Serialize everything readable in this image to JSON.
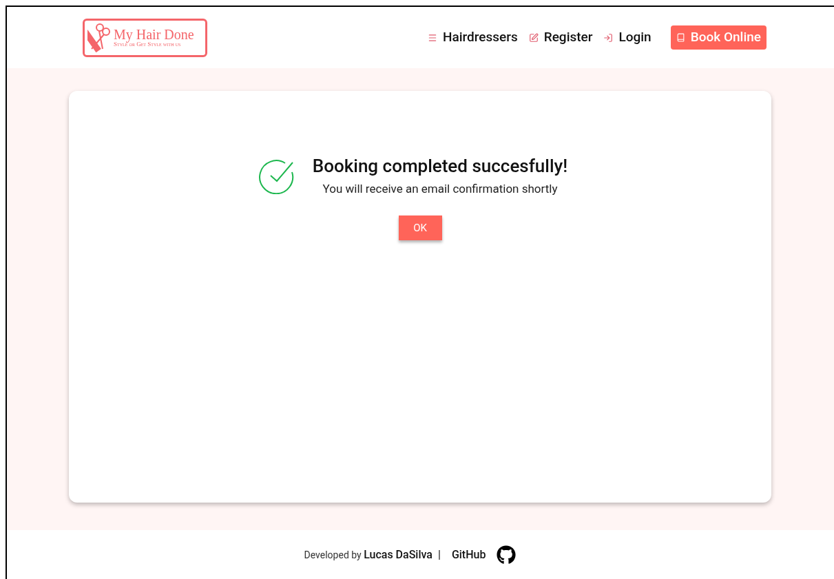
{
  "logo": {
    "title": "My Hair Done",
    "tagline": "Style or Get Style with us"
  },
  "nav": [
    {
      "kind": "list",
      "label": "Hairdressers"
    },
    {
      "kind": "edit",
      "label": "Register"
    },
    {
      "kind": "login",
      "label": "Login"
    },
    {
      "kind": "book",
      "label": "Book Online"
    }
  ],
  "message": {
    "title": "Booking completed succesfully!",
    "subtitle": "You will receive an email confirmation shortly",
    "button": "OK"
  },
  "footer": {
    "prefix": "Developed by",
    "author": "Lucas DaSilva",
    "separator": "|",
    "link": "GitHub"
  }
}
